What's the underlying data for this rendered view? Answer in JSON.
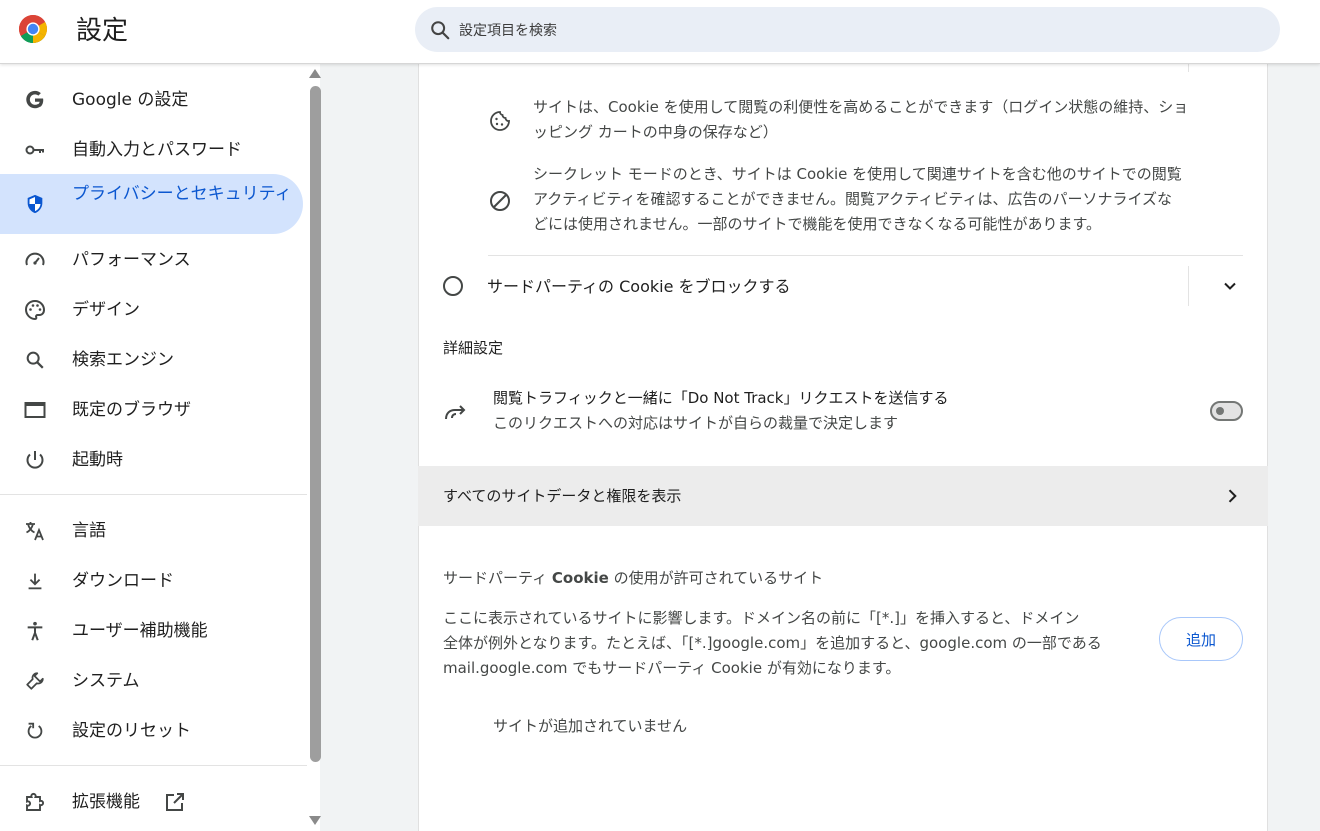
{
  "header": {
    "title": "設定",
    "search_placeholder": "設定項目を検索"
  },
  "sidebar": {
    "items": [
      {
        "label": "Google の設定",
        "icon": "google-g-icon"
      },
      {
        "label": "自動入力とパスワード",
        "icon": "key-icon"
      },
      {
        "label": "プライバシーとセキュリティ",
        "icon": "shield-icon"
      },
      {
        "label": "パフォーマンス",
        "icon": "speedometer-icon"
      },
      {
        "label": "デザイン",
        "icon": "palette-icon"
      },
      {
        "label": "検索エンジン",
        "icon": "search-icon"
      },
      {
        "label": "既定のブラウザ",
        "icon": "browser-window-icon"
      },
      {
        "label": "起動時",
        "icon": "power-icon"
      },
      {
        "label": "言語",
        "icon": "translate-icon"
      },
      {
        "label": "ダウンロード",
        "icon": "download-icon"
      },
      {
        "label": "ユーザー補助機能",
        "icon": "accessibility-icon"
      },
      {
        "label": "システム",
        "icon": "wrench-icon"
      },
      {
        "label": "設定のリセット",
        "icon": "reset-icon"
      },
      {
        "label": "拡張機能",
        "icon": "extension-icon"
      }
    ]
  },
  "main": {
    "cookie_info_1": {
      "line1": "サイトは、Cookie を使用して閲覧の利便性を高めることができます（ログイン状態の維持、ショ",
      "line2": "ッピング カートの中身の保存など）"
    },
    "cookie_info_2": {
      "line1": "シークレット モードのとき、サイトは Cookie を使用して関連サイトを含む他のサイトでの閲覧",
      "line2": "アクティビティを確認することができません。閲覧アクティビティは、広告のパーソナライズな",
      "line3": "どには使用されません。一部のサイトで機能を使用できなくなる可能性があります。"
    },
    "block_third_party_label": "サードパーティの Cookie をブロックする",
    "advanced_heading": "詳細設定",
    "dnt": {
      "title": "閲覧トラフィックと一緒に「Do Not Track」リクエストを送信する",
      "subtitle": "このリクエストへの対応はサイトが自らの裁量で決定します",
      "enabled": false
    },
    "all_site_data_label": "すべてのサイトデータと権限を表示",
    "allowed_sites": {
      "heading_prefix": "サードパーティ ",
      "heading_bold": "Cookie",
      "heading_suffix": " の使用が許可されているサイト",
      "desc_line1": "ここに表示されているサイトに影響します。ドメイン名の前に「[*.]」を挿入すると、ドメイン",
      "desc_line2": "全体が例外となります。たとえば、「[*.]google.com」を追加すると、google.com の一部である",
      "desc_line3": "mail.google.com でもサードパーティ Cookie が有効になります。",
      "add_button": "追加",
      "empty_text": "サイトが追加されていません"
    }
  }
}
